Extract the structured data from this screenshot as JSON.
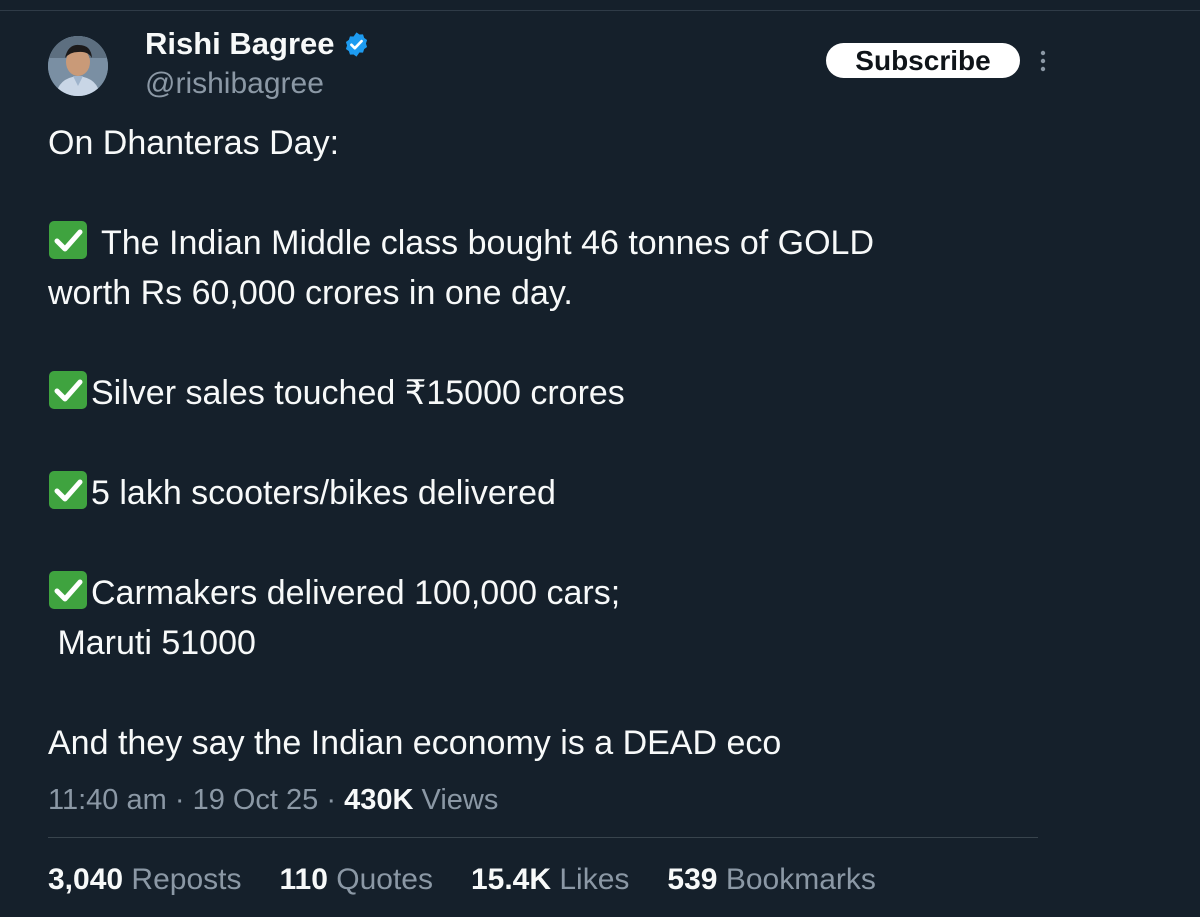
{
  "author": {
    "name": "Rishi Bagree",
    "handle": "@rishibagree",
    "verified_icon": "verified-badge-icon",
    "verified_color": "#1d9bf0"
  },
  "actions": {
    "subscribe_label": "Subscribe",
    "more_icon": "more-vertical-icon"
  },
  "tweet": {
    "intro": "On Dhanteras Day:",
    "point_icon": "white-check-mark-icon",
    "point_icon_color": "#3fa33f",
    "point1_line1": "The Indian Middle class bought 46 tonnes of GOLD",
    "point1_line2": "worth Rs 60,000 crores in one day.",
    "point2": "Silver sales touched ₹15000 crores",
    "point3": "5 lakh scooters/bikes delivered",
    "point4_line1": "Carmakers delivered 100,000 cars;",
    "point4_line2": " Maruti 51000",
    "closing": "And they say the Indian economy is a DEAD eco"
  },
  "meta": {
    "time": "11:40 am",
    "separator": "·",
    "date": "19 Oct 25",
    "views_count": "430K",
    "views_label": "Views"
  },
  "stats": {
    "reposts_count": "3,040",
    "reposts_label": "Reposts",
    "quotes_count": "110",
    "quotes_label": "Quotes",
    "likes_count": "15.4K",
    "likes_label": "Likes",
    "bookmarks_count": "539",
    "bookmarks_label": "Bookmarks"
  },
  "colors": {
    "background": "#15202b",
    "text_primary": "#f7f9f9",
    "text_secondary": "#8b98a5"
  }
}
